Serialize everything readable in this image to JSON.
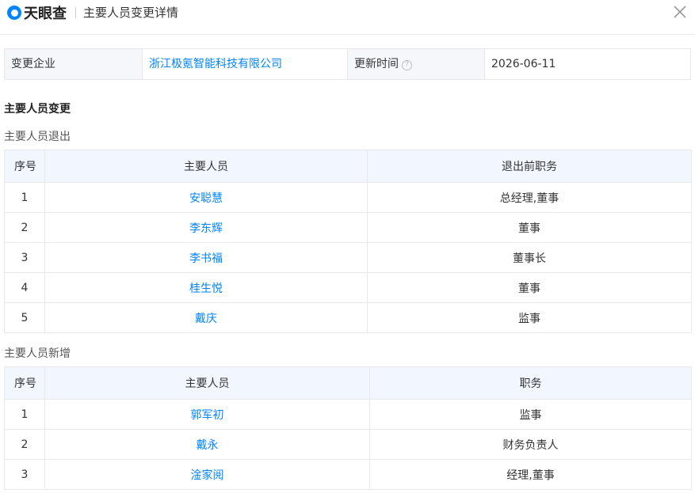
{
  "header": {
    "logo_text": "天眼查",
    "title": "主要人员变更详情"
  },
  "info": {
    "company_label": "变更企业",
    "company_value": "浙江极氪智能科技有限公司",
    "time_label": "更新时间",
    "time_value": "2026-06-11"
  },
  "section_title": "主要人员变更",
  "exit": {
    "title": "主要人员退出",
    "columns": [
      "序号",
      "主要人员",
      "退出前职务"
    ],
    "rows": [
      {
        "no": "1",
        "name": "安聪慧",
        "role": "总经理,董事"
      },
      {
        "no": "2",
        "name": "李东辉",
        "role": "董事"
      },
      {
        "no": "3",
        "name": "李书福",
        "role": "董事长"
      },
      {
        "no": "4",
        "name": "桂生悦",
        "role": "董事"
      },
      {
        "no": "5",
        "name": "戴庆",
        "role": "监事"
      }
    ]
  },
  "added": {
    "title": "主要人员新增",
    "columns": [
      "序号",
      "主要人员",
      "职务"
    ],
    "rows": [
      {
        "no": "1",
        "name": "郭军初",
        "role": "监事"
      },
      {
        "no": "2",
        "name": "戴永",
        "role": "财务负责人"
      },
      {
        "no": "3",
        "name": "淦家阅",
        "role": "经理,董事"
      }
    ]
  },
  "colors": {
    "accent": "#0084ff",
    "header_bg": "#f2f7ff",
    "border": "#e8e8e8"
  },
  "icons": {
    "logo": "tianyancha-logo-icon",
    "close": "close-icon",
    "help": "help-circle-icon"
  }
}
